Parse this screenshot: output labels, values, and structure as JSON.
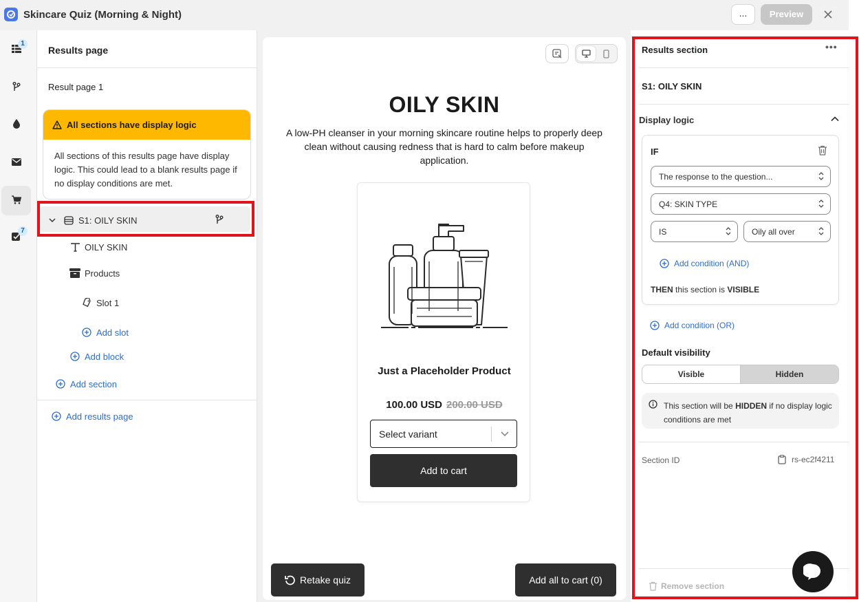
{
  "window": {
    "title": "Skincare Quiz (Morning & Night)",
    "more_label": "...",
    "preview_label": "Preview"
  },
  "rail": {
    "badge_top": "1",
    "badge_bottom": "7"
  },
  "left": {
    "header": "Results page",
    "result_title": "Result page 1",
    "warning_title": "All sections have display logic",
    "warning_body": "All sections of this results page have display logic. This could lead to a blank results page if no display conditions are met.",
    "section_label": "S1: OILY SKIN",
    "items": {
      "text_block": "OILY SKIN",
      "products": "Products",
      "slot": "Slot 1"
    },
    "add_slot": "Add slot",
    "add_block": "Add block",
    "add_section": "Add section",
    "add_results_page": "Add results page"
  },
  "canvas": {
    "title": "OILY SKIN",
    "description": "A low-PH cleanser in your morning skincare routine helps to properly deep clean without causing redness that is hard to calm before makeup application.",
    "product": {
      "name": "Just a Placeholder Product",
      "price": "100.00 USD",
      "compare_price": "200.00 USD",
      "variant_placeholder": "Select variant",
      "add_to_cart": "Add to cart"
    },
    "retake": "Retake quiz",
    "add_all": "Add all to cart (0)"
  },
  "right": {
    "title": "Results section",
    "section_name": "S1: OILY SKIN",
    "display_logic": "Display logic",
    "if_label": "IF",
    "cond_source": "The response to the question...",
    "cond_question": "Q4: SKIN TYPE",
    "cond_operator": "IS",
    "cond_value": "Oily all over",
    "add_and": "Add condition (AND)",
    "then_prefix": "THEN",
    "then_middle": "this section is",
    "then_state": "VISIBLE",
    "add_or": "Add condition (OR)",
    "default_visibility": "Default visibility",
    "visible_label": "Visible",
    "hidden_label": "Hidden",
    "info_prefix": "This section will be",
    "info_state": "HIDDEN",
    "info_suffix": "if no display logic conditions are met",
    "section_id_label": "Section ID",
    "section_id": "rs-ec2f4211",
    "remove_section": "Remove section"
  },
  "colors": {
    "accent": "#2c6ecb",
    "warning": "#ffb800",
    "highlight": "#e0141b",
    "dark_button": "#2f2f2f"
  }
}
